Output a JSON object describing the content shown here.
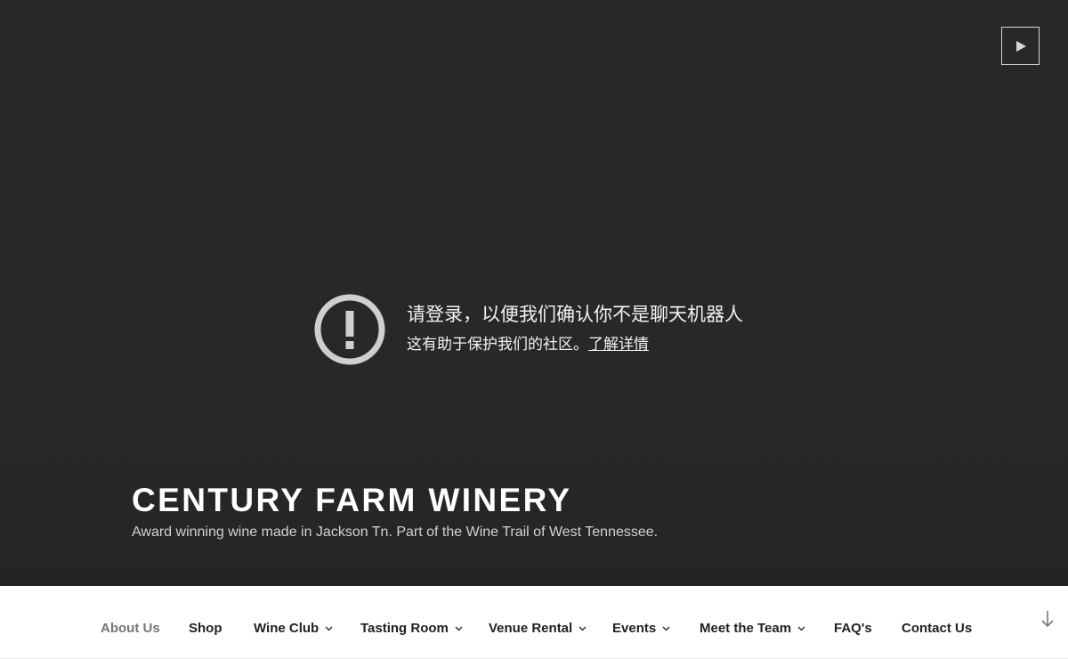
{
  "hero": {
    "play_button_label": "Play background video"
  },
  "notice": {
    "title": "请登录，以便我们确认你不是聊天机器人",
    "subtitle": "这有助于保护我们的社区。",
    "link": "了解详情"
  },
  "site": {
    "title": "CENTURY FARM WINERY",
    "tagline": "Award winning wine made in Jackson Tn. Part of the Wine Trail of West Tennessee."
  },
  "nav": {
    "items": [
      {
        "label": "About Us",
        "current": true,
        "has_dropdown": false
      },
      {
        "label": "Shop",
        "current": false,
        "has_dropdown": false
      },
      {
        "label": "Wine Club",
        "current": false,
        "has_dropdown": true
      },
      {
        "label": "Tasting Room",
        "current": false,
        "has_dropdown": true
      },
      {
        "label": "Venue Rental",
        "current": false,
        "has_dropdown": true
      },
      {
        "label": "Events",
        "current": false,
        "has_dropdown": true
      },
      {
        "label": "Meet the Team",
        "current": false,
        "has_dropdown": true
      },
      {
        "label": "FAQ's",
        "current": false,
        "has_dropdown": false
      },
      {
        "label": "Contact Us",
        "current": false,
        "has_dropdown": false
      }
    ],
    "scroll_icon": "arrow-down-icon"
  },
  "colors": {
    "hero_background": "#282828",
    "title_text": "#ffffff",
    "nav_text": "#222222",
    "nav_current": "#767676",
    "notice_icon": "#cfcfcf"
  }
}
